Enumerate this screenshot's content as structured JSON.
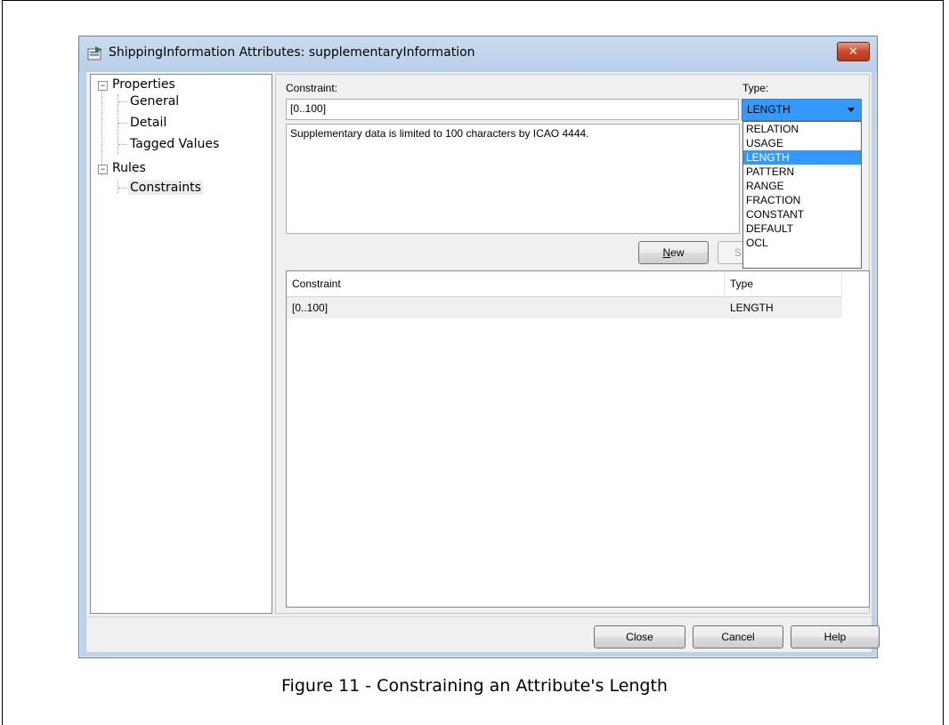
{
  "window": {
    "title": "ShippingInformation Attributes: supplementaryInformation",
    "close_glyph": "✕"
  },
  "tree": {
    "properties": "Properties",
    "general": "General",
    "detail": "Detail",
    "tagged_values": "Tagged Values",
    "rules": "Rules",
    "constraints": "Constraints",
    "expander_glyph": "−"
  },
  "form": {
    "constraint_label": "Constraint:",
    "constraint_value": "[0..100]",
    "type_label": "Type:",
    "type_value": "LENGTH",
    "notes": "Supplementary data is limited to 100 characters by ICAO 4444."
  },
  "type_options": [
    "RELATION",
    "USAGE",
    "LENGTH",
    "PATTERN",
    "RANGE",
    "FRACTION",
    "CONSTANT",
    "DEFAULT",
    "OCL"
  ],
  "buttons": {
    "new": "New",
    "new_accel": "N",
    "new_rest": "ew",
    "save_partial": "S",
    "close": "Close",
    "cancel": "Cancel",
    "help": "Help"
  },
  "list": {
    "columns": [
      "Constraint",
      "Type"
    ],
    "rows": [
      [
        "[0..100]",
        "LENGTH"
      ]
    ]
  },
  "caption": "Figure 11 - Constraining an Attribute's Length"
}
